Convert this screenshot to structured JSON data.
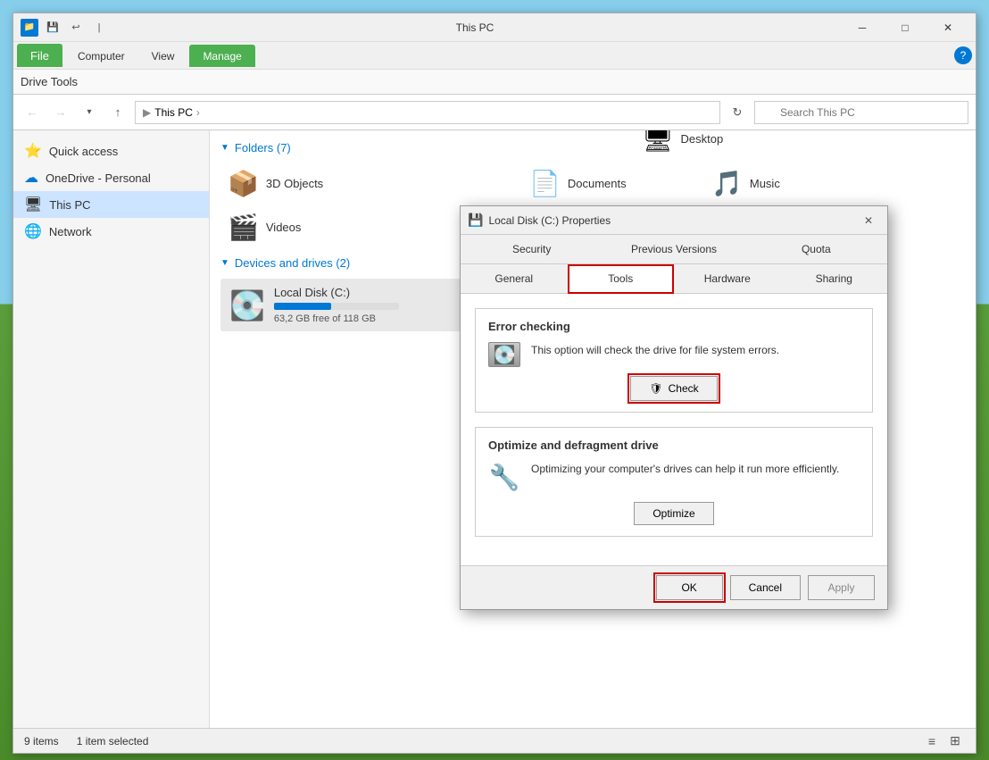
{
  "window": {
    "title": "This PC",
    "manage_label": "Manage",
    "drive_tools_label": "Drive Tools"
  },
  "ribbon": {
    "tabs": [
      {
        "label": "File",
        "active": true,
        "color": "green"
      },
      {
        "label": "Computer"
      },
      {
        "label": "View"
      },
      {
        "label": "Drive Tools"
      }
    ],
    "manage_tab": "Manage"
  },
  "address_bar": {
    "path": "This PC",
    "search_placeholder": "Search This PC"
  },
  "sidebar": {
    "items": [
      {
        "label": "Quick access",
        "icon": "⭐"
      },
      {
        "label": "OneDrive - Personal",
        "icon": "☁"
      },
      {
        "label": "This PC",
        "icon": "🖥",
        "active": true
      },
      {
        "label": "Network",
        "icon": "🌐"
      }
    ]
  },
  "content": {
    "folders_header": "Folders (7)",
    "folders": [
      {
        "name": "3D Objects",
        "icon": "📦"
      },
      {
        "name": "Desktop",
        "icon": "🖥"
      },
      {
        "name": "Documents",
        "icon": "📄"
      },
      {
        "name": "Music",
        "icon": "🎵"
      },
      {
        "name": "Videos",
        "icon": "🎬"
      }
    ],
    "drives_header": "Devices and drives (2)",
    "drives": [
      {
        "name": "Local Disk (C:)",
        "icon": "💿",
        "space_label": "63,2 GB free of 118 GB",
        "fill_percent": 46
      }
    ]
  },
  "status_bar": {
    "items_count": "9 items",
    "selected": "1 item selected"
  },
  "dialog": {
    "title": "Local Disk (C:) Properties",
    "tabs": [
      {
        "label": "Security"
      },
      {
        "label": "Previous Versions"
      },
      {
        "label": "Quota"
      },
      {
        "label": "General"
      },
      {
        "label": "Tools",
        "active": true
      },
      {
        "label": "Hardware"
      },
      {
        "label": "Sharing"
      }
    ],
    "error_checking": {
      "title": "Error checking",
      "description": "This option will check the drive for file system errors.",
      "check_label": "Check"
    },
    "optimize": {
      "title": "Optimize and defragment drive",
      "description": "Optimizing your computer's drives can help it run more efficiently.",
      "optimize_label": "Optimize"
    },
    "footer": {
      "ok_label": "OK",
      "cancel_label": "Cancel",
      "apply_label": "Apply"
    }
  }
}
